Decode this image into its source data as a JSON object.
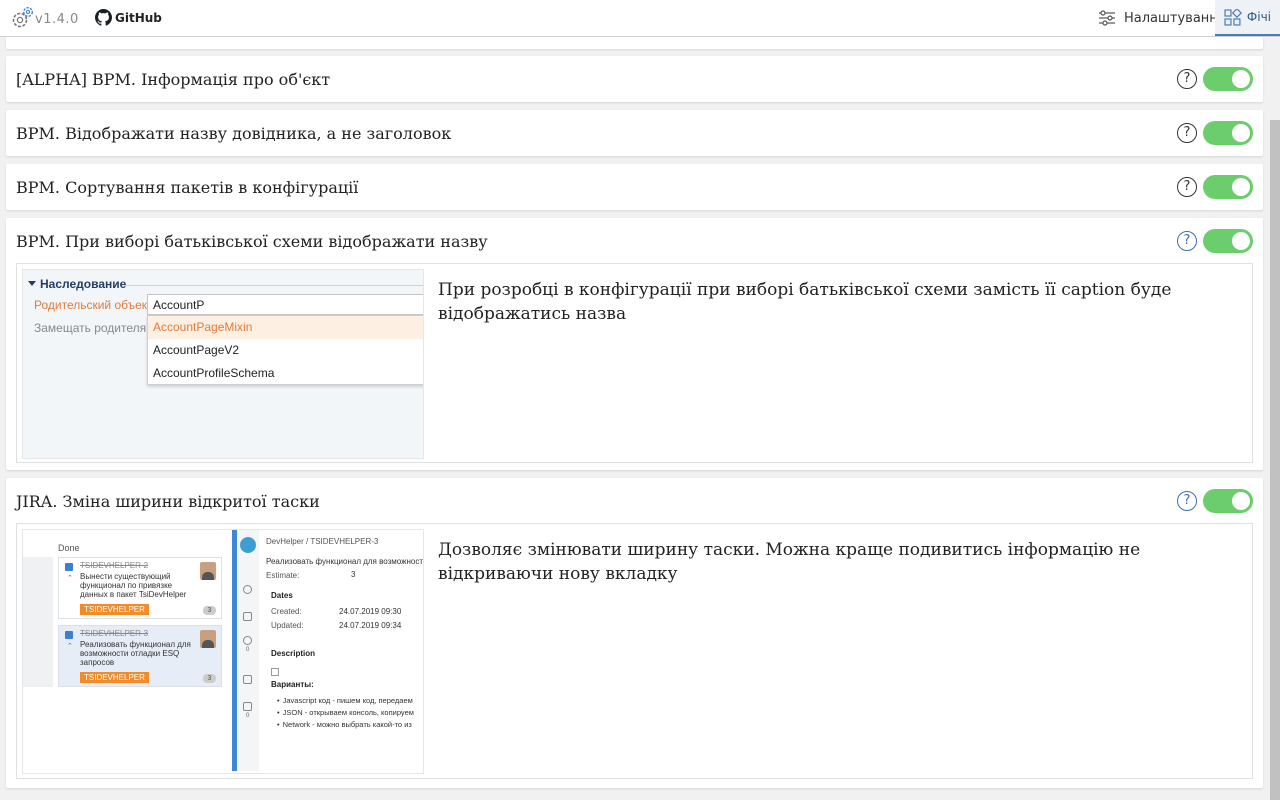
{
  "header": {
    "version": "v1.4.0",
    "github_label": "GitHub",
    "settings_tab_label": "Налаштування",
    "features_tab_label": "Фічі",
    "icons": [
      "gear-icon",
      "github-icon",
      "sliders-icon",
      "features-grid-icon"
    ]
  },
  "colors": {
    "toggle_on": "#6ccd6c",
    "active_tab_underline": "#4a7bb7",
    "help_blue": "#3f6fb0"
  },
  "features": [
    {
      "title": "[ALPHA] BPM. Інформація про об'єкт",
      "enabled": true
    },
    {
      "title": "BPM. Відображати назву довідника, а не заголовок",
      "enabled": true
    },
    {
      "title": "BPM. Сортування пакетів в конфігурації",
      "enabled": true
    },
    {
      "title": "BPM. При виборі батьківської схеми відображати назву",
      "enabled": true,
      "description": "При розробці в конфігурації при виборі батьківської схеми замість її caption буде відображатись назва",
      "screenshot": {
        "section": "Наследование",
        "label_parent": "Родительский объект",
        "label_replace": "Замещать родителя",
        "input_value": "AccountP",
        "options": [
          "AccountPageMixin",
          "AccountPageV2",
          "AccountProfileSchema"
        ]
      }
    },
    {
      "title": "JIRA. Зміна ширини відкритої таски",
      "enabled": true,
      "description": "Дозволяє змінювати ширину таски. Можна краще подивитись інформацію не відкриваючи нову вкладку",
      "screenshot": {
        "column": "Done",
        "issues": [
          {
            "key": "TSIDEVHELPER-2",
            "summary": "Вынести существующий функционал по привязке данных в пакет TsiDevHelper",
            "tag": "TSIDEVHELPER",
            "count": "3"
          },
          {
            "key": "TSIDEVHELPER-3",
            "summary": "Реализовать функционал для возможности отладки ESQ запросов",
            "tag": "TSIDEVHELPER",
            "count": "3"
          }
        ],
        "breadcrumb": "DevHelper /  TSIDEVHELPER-3",
        "issue_title": "Реализовать функционал для возможности",
        "estimate_label": "Estimate:",
        "estimate_value": "3",
        "dates_heading": "Dates",
        "created_label": "Created:",
        "created_value": "24.07.2019 09:30",
        "updated_label": "Updated:",
        "updated_value": "24.07.2019 09:34",
        "description_heading": "Description",
        "variants_heading": "Варианты:",
        "variants": [
          "Javascript код - пишем код, передаем",
          "JSON - открываем консоль, копируем",
          "Network - можно выбрать какой-то из"
        ],
        "side_counts": [
          "0",
          "0"
        ]
      }
    }
  ]
}
